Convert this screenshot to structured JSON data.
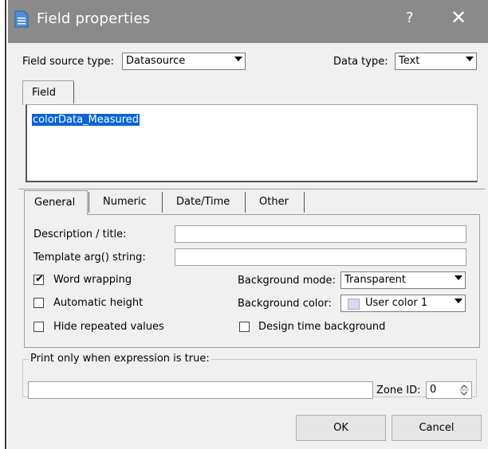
{
  "window": {
    "title": "Field properties",
    "help_glyph": "?",
    "close_glyph": "✕",
    "title_bar_color": "#8a8a8a"
  },
  "source": {
    "field_source_type_label": "Field source type:",
    "field_source_type_value": "Datasource",
    "data_type_label": "Data type:",
    "data_type_value": "Text"
  },
  "field_tab": {
    "label": "Field",
    "content": "colorData_Measured"
  },
  "tabs": {
    "general": "General",
    "numeric": "Numeric",
    "datetime": "Date/Time",
    "other": "Other",
    "active": "General"
  },
  "general": {
    "description_label": "Description / title:",
    "description_value": "",
    "template_label": "Template arg() string:",
    "template_value": "",
    "word_wrapping_label": "Word wrapping",
    "word_wrapping_checked": true,
    "automatic_height_label": "Automatic height",
    "automatic_height_checked": false,
    "hide_repeated_label": "Hide repeated values",
    "hide_repeated_checked": false,
    "background_mode_label": "Background mode:",
    "background_mode_value": "Transparent",
    "background_color_label": "Background color:",
    "background_color_value": "User color 1",
    "background_color_swatch": "#d8d8f4",
    "design_time_bg_label": "Design time background",
    "design_time_bg_checked": false
  },
  "print_group": {
    "title": "Print only when expression is true:",
    "expression_value": "",
    "zone_id_label": "Zone ID:",
    "zone_id_value": "0"
  },
  "buttons": {
    "ok": "OK",
    "cancel": "Cancel"
  },
  "icons": {
    "window_icon": "document-icon",
    "checkmark": "✔"
  }
}
